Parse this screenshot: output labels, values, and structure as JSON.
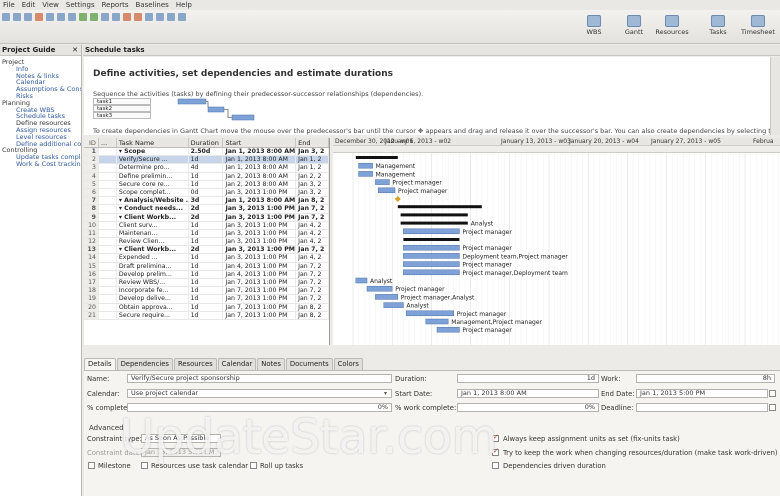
{
  "menu": [
    "File",
    "Edit",
    "View",
    "Settings",
    "Reports",
    "Baselines",
    "Help"
  ],
  "views": [
    "WBS",
    "Gantt",
    "Resources",
    "Tasks",
    "Timesheet"
  ],
  "guide": {
    "title": "Project Guide",
    "items": [
      {
        "label": "Project",
        "type": "sec"
      },
      {
        "label": "Info",
        "type": "sub"
      },
      {
        "label": "Notes & links",
        "type": "sub"
      },
      {
        "label": "Calendar",
        "type": "sub"
      },
      {
        "label": "Assumptions & Constraints",
        "type": "sub"
      },
      {
        "label": "Risks",
        "type": "sub"
      },
      {
        "label": "Planning",
        "type": "sec"
      },
      {
        "label": "Create WBS",
        "type": "sub"
      },
      {
        "label": "Schedule tasks",
        "type": "sub"
      },
      {
        "label": "Define resources",
        "type": "sub active"
      },
      {
        "label": "Assign resources",
        "type": "sub"
      },
      {
        "label": "Level resources",
        "type": "sub"
      },
      {
        "label": "Define additional costs",
        "type": "sub"
      },
      {
        "label": "Controlling",
        "type": "sec"
      },
      {
        "label": "Update tasks completion",
        "type": "sub"
      },
      {
        "label": "Work & Cost tracking",
        "type": "sub"
      }
    ]
  },
  "schedule": {
    "header": "Schedule tasks",
    "title": "Define activities, set dependencies and estimate durations",
    "text1": "Sequence the activities (tasks) by defining their predecessor-successor relationships (dependencies).",
    "mini_tasks": [
      "task1",
      "task2",
      "task3"
    ],
    "text2": "To create dependencies in Gantt Chart move the mouse over the predecessor's bar until the cursor ✥ appears and drag and release it over the successor's bar. You can also create dependencies by selecting the"
  },
  "table": {
    "columns": [
      "ID",
      "...",
      "Task Name",
      "Duration",
      "Start",
      "End"
    ],
    "rows": [
      {
        "id": "1",
        "name": "▾  Scope",
        "dur": "2.50d",
        "start": "Jan 1, 2013 8:00 AM",
        "end": "Jan 3, 2",
        "bold": true
      },
      {
        "id": "2",
        "name": "Verify/Secure ...",
        "dur": "1d",
        "start": "Jan 1, 2013 8:00 AM",
        "end": "Jan 1, 2",
        "sel": true
      },
      {
        "id": "3",
        "name": "Determine pro...",
        "dur": "4d",
        "start": "Jan 1, 2013 8:00 AM",
        "end": "Jan 1, 2"
      },
      {
        "id": "4",
        "name": "Define prelimin...",
        "dur": "1d",
        "start": "Jan 2, 2013 8:00 AM",
        "end": "Jan 2, 2"
      },
      {
        "id": "5",
        "name": "Secure core re...",
        "dur": "1d",
        "start": "Jan 2, 2013 8:00 AM",
        "end": "Jan 3, 2"
      },
      {
        "id": "6",
        "name": "Scope complet...",
        "dur": "0d",
        "start": "Jan 3, 2013 1:00 PM",
        "end": "Jan 3, 2"
      },
      {
        "id": "7",
        "name": "▾  Analysis/Website ...",
        "dur": "3d",
        "start": "Jan 1, 2013 8:00 AM",
        "end": "Jan 8, 2",
        "bold": true
      },
      {
        "id": "8",
        "name": "▾ Conduct needs...",
        "dur": "2d",
        "start": "Jan 3, 2013 1:00 PM",
        "end": "Jan 7, 2",
        "bold": true
      },
      {
        "id": "9",
        "name": "▾ Client Workb...",
        "dur": "2d",
        "start": "Jan 3, 2013 1:00 PM",
        "end": "Jan 7, 2",
        "bold": true
      },
      {
        "id": "10",
        "name": "Client surv...",
        "dur": "1d",
        "start": "Jan 3, 2013 1:00 PM",
        "end": "Jan 4, 2"
      },
      {
        "id": "11",
        "name": "Maintenan...",
        "dur": "1d",
        "start": "Jan 3, 2013 1:00 PM",
        "end": "Jan 4, 2"
      },
      {
        "id": "12",
        "name": "Review Clien...",
        "dur": "1d",
        "start": "Jan 3, 2013 1:00 PM",
        "end": "Jan 4, 2"
      },
      {
        "id": "13",
        "name": "▾ Client Workb...",
        "dur": "2d",
        "start": "Jan 3, 2013 1:00 PM",
        "end": "Jan 7, 2",
        "bold": true
      },
      {
        "id": "14",
        "name": "Expended ...",
        "dur": "1d",
        "start": "Jan 3, 2013 1:00 PM",
        "end": "Jan 4, 2"
      },
      {
        "id": "15",
        "name": "Draft prelimina...",
        "dur": "1d",
        "start": "Jan 4, 2013 1:00 PM",
        "end": "Jan 7, 2"
      },
      {
        "id": "16",
        "name": "Develop prelim...",
        "dur": "1d",
        "start": "Jan 4, 2013 1:00 PM",
        "end": "Jan 7, 2"
      },
      {
        "id": "17",
        "name": "Review WBS/...",
        "dur": "1d",
        "start": "Jan 7, 2013 1:00 PM",
        "end": "Jan 7, 2"
      },
      {
        "id": "18",
        "name": "Incorporate fe...",
        "dur": "1d",
        "start": "Jan 7, 2013 1:00 PM",
        "end": "Jan 7, 2"
      },
      {
        "id": "19",
        "name": "Develop delive...",
        "dur": "1d",
        "start": "Jan 7, 2013 1:00 PM",
        "end": "Jan 7, 2"
      },
      {
        "id": "20",
        "name": "Obtain approva...",
        "dur": "1d",
        "start": "Jan 7, 2013 1:00 PM",
        "end": "Jan 8, 2"
      },
      {
        "id": "21",
        "name": "Secure require...",
        "dur": "1d",
        "start": "Jan 7, 2013 1:00 PM",
        "end": "Jan 8, 2"
      }
    ]
  },
  "gantt": {
    "top_labels": [
      "December 30, 2012 - w01",
      "January 6, 2013 - w02",
      "January 13, 2013 - w03",
      "January 20, 2013 - w04",
      "January 27, 2013 - w05",
      "Februa"
    ],
    "bars": [
      {
        "row": 0,
        "start": 0.5,
        "len": 7.5,
        "summary": true,
        "label": ""
      },
      {
        "row": 1,
        "start": 1.0,
        "len": 2.5,
        "label": "Management"
      },
      {
        "row": 2,
        "start": 1.0,
        "len": 2.5,
        "label": "Management"
      },
      {
        "row": 3,
        "start": 4.0,
        "len": 2.5,
        "label": "Project manager"
      },
      {
        "row": 4,
        "start": 4.5,
        "len": 3.0,
        "label": "Project manager"
      },
      {
        "row": 5,
        "start": 8.0,
        "len": 0,
        "milestone": true,
        "label": ""
      },
      {
        "row": 6,
        "start": 8.0,
        "len": 15.0,
        "summary": true,
        "label": ""
      },
      {
        "row": 7,
        "start": 8.5,
        "len": 12.0,
        "summary": true,
        "label": ""
      },
      {
        "row": 8,
        "start": 8.5,
        "len": 12.0,
        "summary": true,
        "label": "Analyst"
      },
      {
        "row": 9,
        "start": 9.0,
        "len": 10.0,
        "label": "Project manager"
      },
      {
        "row": 10,
        "start": 9.0,
        "len": 10.0,
        "summary": true,
        "label": ""
      },
      {
        "row": 11,
        "start": 9.0,
        "len": 10.0,
        "label": "Project manager"
      },
      {
        "row": 12,
        "start": 9.0,
        "len": 10.0,
        "label": "Deployment team,Project manager"
      },
      {
        "row": 13,
        "start": 9.0,
        "len": 10.0,
        "label": "Project manager"
      },
      {
        "row": 14,
        "start": 9.0,
        "len": 10.0,
        "label": "Project manager,Deployment team"
      },
      {
        "row": 15,
        "start": 0.5,
        "len": 2.0,
        "label": "Analyst"
      },
      {
        "row": 16,
        "start": 2.5,
        "len": 4.5,
        "label": "Project manager"
      },
      {
        "row": 17,
        "start": 4.0,
        "len": 4.0,
        "label": "Project manager,Analyst"
      },
      {
        "row": 18,
        "start": 5.5,
        "len": 3.5,
        "label": "Analyst"
      },
      {
        "row": 19,
        "start": 9.5,
        "len": 8.5,
        "label": "Project manager"
      },
      {
        "row": 20,
        "start": 13.0,
        "len": 4.0,
        "label": "Management,Project manager"
      },
      {
        "row": 21,
        "start": 15.0,
        "len": 4.0,
        "label": "Project manager"
      }
    ]
  },
  "tabs": [
    "Details",
    "Dependencies",
    "Resources",
    "Calendar",
    "Notes",
    "Documents",
    "Colors"
  ],
  "details": {
    "name_label": "Name:",
    "name_value": "Verify/Secure project sponsorship",
    "duration_label": "Duration:",
    "duration_value": "1d",
    "work_label": "Work:",
    "work_value": "8h",
    "calendar_label": "Calendar:",
    "calendar_value": "Use project calendar",
    "start_label": "Start Date:",
    "start_value": "Jan 1, 2013 8:00 AM",
    "end_label": "End Date:",
    "end_value": "Jan 1, 2013 5:00 PM",
    "complete_label": "% complete:",
    "complete_value": "0%",
    "work_complete_label": "% work complete:",
    "work_complete_value": "0%",
    "deadline_label": "Deadline:",
    "advanced_label": "Advanced",
    "constraint_type_label": "Constraint type:",
    "constraint_type_value": "As Soon As Possible",
    "constraint_date_label": "Constraint date:",
    "constraint_date_value": "Jan 15, 2013 5:00 PM",
    "always_keep_label": "Always keep assignment units as set (fix-units task)",
    "try_keep_label": "Try to keep the work when changing resources/duration (make task work-driven)",
    "deps_driven_label": "Dependencies driven duration",
    "milestone_label": "Milestone",
    "resources_calendar_label": "Resources use task calendar",
    "rollup_label": "Roll up tasks"
  },
  "watermark": "UpdateStar.com",
  "colors": {
    "bar": "#7ea2d8",
    "summary": "#111111",
    "selection": "#c7d5ea",
    "link": "#2f5a9e"
  }
}
